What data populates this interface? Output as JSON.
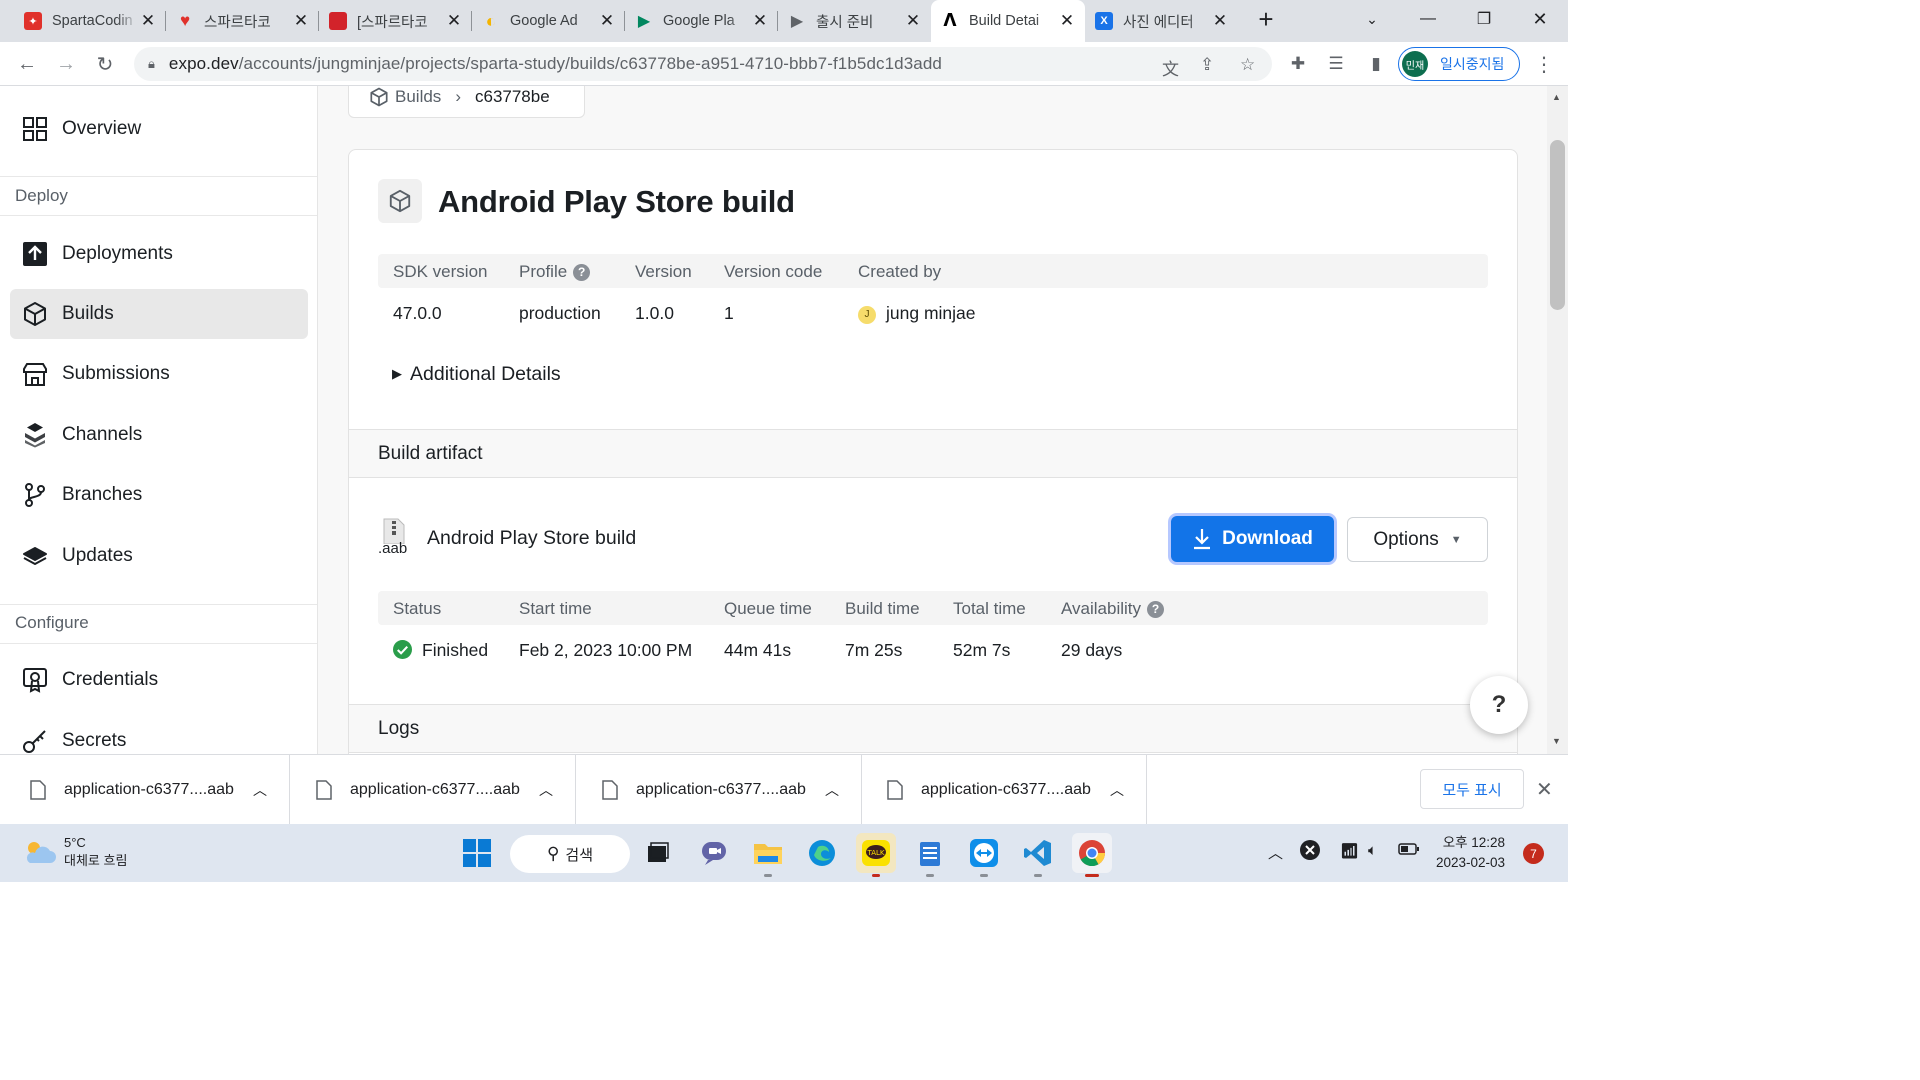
{
  "browser": {
    "tabs": [
      {
        "title": "SpartaCodin",
        "favicon": "sparta-icon",
        "color": "#e0312b"
      },
      {
        "title": "스파르타코",
        "favicon": "heart-icon",
        "color": "#e0312b"
      },
      {
        "title": "[스파르타코",
        "favicon": "red-book-icon",
        "color": "#d2232a"
      },
      {
        "title": "Google Ad",
        "favicon": "google-ads-icon",
        "color": "#f4b400"
      },
      {
        "title": "Google Pla",
        "favicon": "google-play-icon",
        "color": "#01875f"
      },
      {
        "title": "출시 준비",
        "favicon": "play-console-icon",
        "color": "#5f6368"
      },
      {
        "title": "Build Detai",
        "favicon": "expo-icon",
        "color": "#000000",
        "active": true
      },
      {
        "title": "사진 에디터",
        "favicon": "photo-editor-icon",
        "color": "#1a73e8"
      }
    ],
    "url_host": "expo.dev",
    "url_path": "/accounts/jungminjae/projects/sparta-study/builds/c63778be-a951-4710-bbb7-f1b5dc1d3add",
    "profile_initials": "민재",
    "profile_label": "일시중지됨"
  },
  "sidebar": {
    "top_item": "Overview",
    "groups": [
      {
        "label": "Deploy",
        "items": [
          "Deployments",
          "Builds",
          "Submissions",
          "Channels",
          "Branches",
          "Updates"
        ]
      },
      {
        "label": "Configure",
        "items": [
          "Credentials",
          "Secrets"
        ]
      }
    ],
    "active_item": "Builds"
  },
  "breadcrumb": {
    "root": "Builds",
    "current": "c63778be"
  },
  "build": {
    "title": "Android Play Store build",
    "headers": [
      "SDK version",
      "Profile",
      "Version",
      "Version code",
      "Created by"
    ],
    "values": [
      "47.0.0",
      "production",
      "1.0.0",
      "1",
      "jung minjae"
    ],
    "creator_initial": "J",
    "details_label": "Additional Details"
  },
  "artifact": {
    "section_title": "Build artifact",
    "file_ext": ".aab",
    "name": "Android Play Store build",
    "download_label": "Download",
    "options_label": "Options",
    "headers": [
      "Status",
      "Start time",
      "Queue time",
      "Build time",
      "Total time",
      "Availability"
    ],
    "values": [
      "Finished",
      "Feb 2, 2023 10:00 PM",
      "44m 41s",
      "7m 25s",
      "52m 7s",
      "29 days"
    ],
    "status_color": "#2a9d4a"
  },
  "logs": {
    "section_title": "Logs"
  },
  "help_label": "?",
  "downloads": {
    "files": [
      "application-c6377....aab",
      "application-c6377....aab",
      "application-c6377....aab",
      "application-c6377....aab"
    ],
    "show_all": "모두 표시"
  },
  "taskbar": {
    "weather_temp": "5°C",
    "weather_desc": "대체로 흐림",
    "search_label": "검색",
    "time": "오후 12:28",
    "date": "2023-02-03",
    "notification_count": "7"
  }
}
